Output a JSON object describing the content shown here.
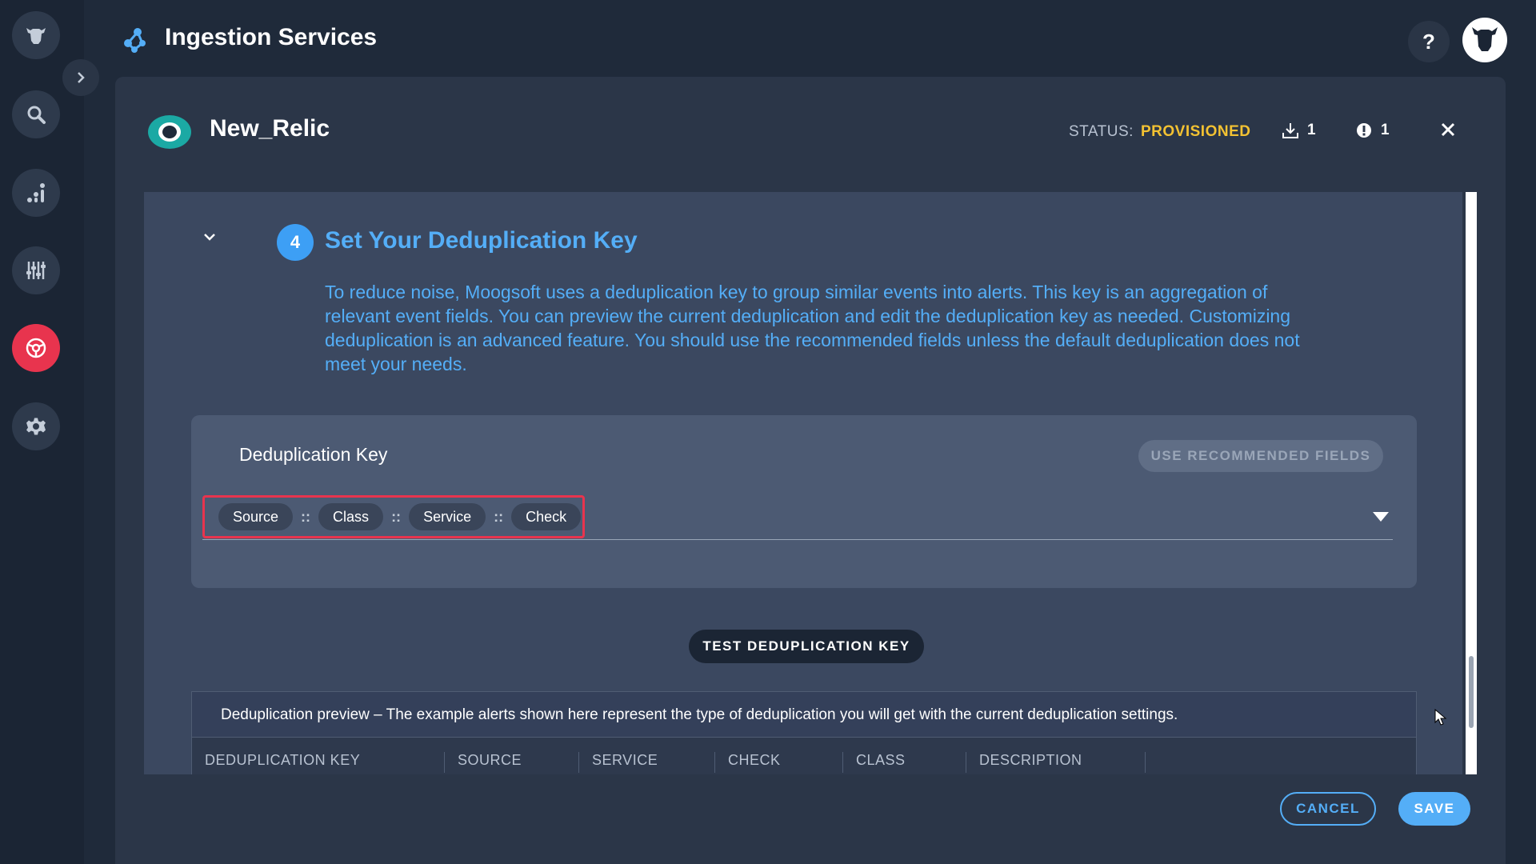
{
  "header": {
    "title": "Ingestion Services",
    "help_label": "?"
  },
  "integration": {
    "name": "New_Relic",
    "status_label": "STATUS:",
    "status_value": "PROVISIONED",
    "ingest_count": "1",
    "info_count": "1"
  },
  "step": {
    "number": "4",
    "title": "Set Your Deduplication Key",
    "description": "To reduce noise, Moogsoft uses a deduplication key to group similar events into alerts. This key is an aggregation of relevant event fields. You can preview the current deduplication and edit the deduplication key as needed. Customizing deduplication is an advanced feature. You should use the recommended fields unless the default deduplication does not meet your needs."
  },
  "dedup": {
    "title": "Deduplication Key",
    "recommend_label": "USE RECOMMENDED FIELDS",
    "separator": "::",
    "chips": [
      "Source",
      "Class",
      "Service",
      "Check"
    ],
    "test_label": "TEST DEDUPLICATION KEY"
  },
  "preview": {
    "text": "Deduplication preview – The example alerts shown here represent the type of deduplication you will get with the current deduplication settings.",
    "columns": [
      "DEDUPLICATION KEY",
      "SOURCE",
      "SERVICE",
      "CHECK",
      "CLASS",
      "DESCRIPTION"
    ]
  },
  "footer": {
    "cancel_label": "CANCEL",
    "save_label": "SAVE"
  },
  "colors": {
    "accent": "#54aef7",
    "status": "#f3c232",
    "active_nav": "#e8344e",
    "highlight": "#e8344e"
  },
  "icons": {
    "sidebar": [
      "moogsoft-logo-icon",
      "search-icon",
      "analytics-icon",
      "sliders-icon",
      "integrations-icon",
      "gear-icon"
    ],
    "header": [
      "ingestion-services-icon",
      "help-icon",
      "user-avatar-icon"
    ],
    "card": [
      "new-relic-icon",
      "download-icon",
      "info-icon",
      "close-icon"
    ]
  }
}
